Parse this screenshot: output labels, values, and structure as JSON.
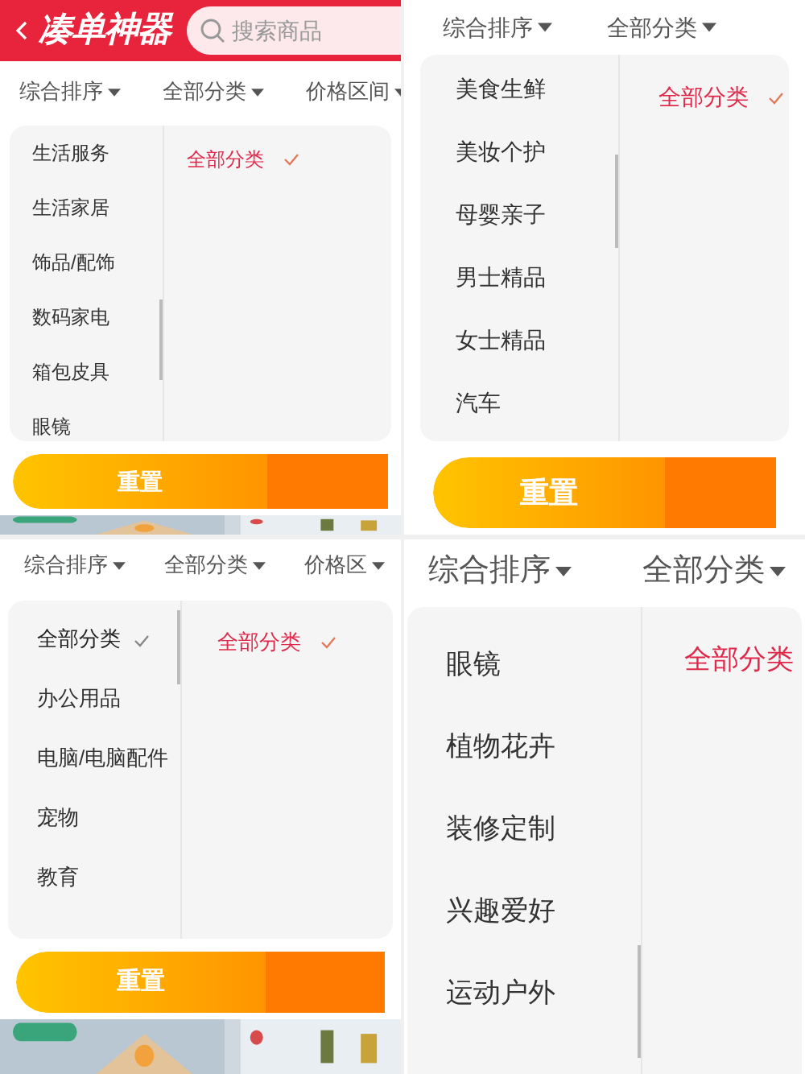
{
  "panels": [
    {
      "header": {
        "title": "凑单神器",
        "search": {
          "placeholder": "搜索商品"
        }
      },
      "filters": [
        {
          "label": "综合排序"
        },
        {
          "label": "全部分类"
        },
        {
          "label": "价格区间"
        }
      ],
      "categories": [
        {
          "label": "生活服务",
          "selected": false
        },
        {
          "label": "生活家居",
          "selected": false
        },
        {
          "label": "饰品/配饰",
          "selected": false
        },
        {
          "label": "数码家电",
          "selected": false
        },
        {
          "label": "箱包皮具",
          "selected": false
        },
        {
          "label": "眼镜",
          "selected": false
        }
      ],
      "subcategories": [
        {
          "label": "全部分类",
          "selected": true
        }
      ],
      "reset_button": "重置",
      "product_strip": {
        "kind": "picture"
      }
    },
    {
      "filters": [
        {
          "label": "综合排序"
        },
        {
          "label": "全部分类"
        }
      ],
      "categories": [
        {
          "label": "美食生鲜",
          "selected": false
        },
        {
          "label": "美妆个护",
          "selected": false
        },
        {
          "label": "母婴亲子",
          "selected": false
        },
        {
          "label": "男士精品",
          "selected": false
        },
        {
          "label": "女士精品",
          "selected": false
        },
        {
          "label": "汽车",
          "selected": false
        }
      ],
      "subcategories": [
        {
          "label": "全部分类",
          "selected": true
        }
      ],
      "reset_button": "重置"
    },
    {
      "filters": [
        {
          "label": "综合排序"
        },
        {
          "label": "全部分类"
        },
        {
          "label": "价格区"
        }
      ],
      "categories": [
        {
          "label": "全部分类",
          "selected": true
        },
        {
          "label": "办公用品",
          "selected": false
        },
        {
          "label": "电脑/电脑配件",
          "selected": false
        },
        {
          "label": "宠物",
          "selected": false
        },
        {
          "label": "教育",
          "selected": false
        }
      ],
      "subcategories": [
        {
          "label": "全部分类",
          "selected": true
        }
      ],
      "reset_button": "重置",
      "product_strip": {
        "kind": "picture"
      }
    },
    {
      "filters": [
        {
          "label": "综合排序"
        },
        {
          "label": "全部分类"
        }
      ],
      "categories": [
        {
          "label": "眼镜",
          "selected": false
        },
        {
          "label": "植物花卉",
          "selected": false
        },
        {
          "label": "装修定制",
          "selected": false
        },
        {
          "label": "兴趣爱好",
          "selected": false
        },
        {
          "label": "运动户外",
          "selected": false
        }
      ],
      "subcategories": [
        {
          "label": "全部分类",
          "selected": true
        }
      ]
    }
  ]
}
